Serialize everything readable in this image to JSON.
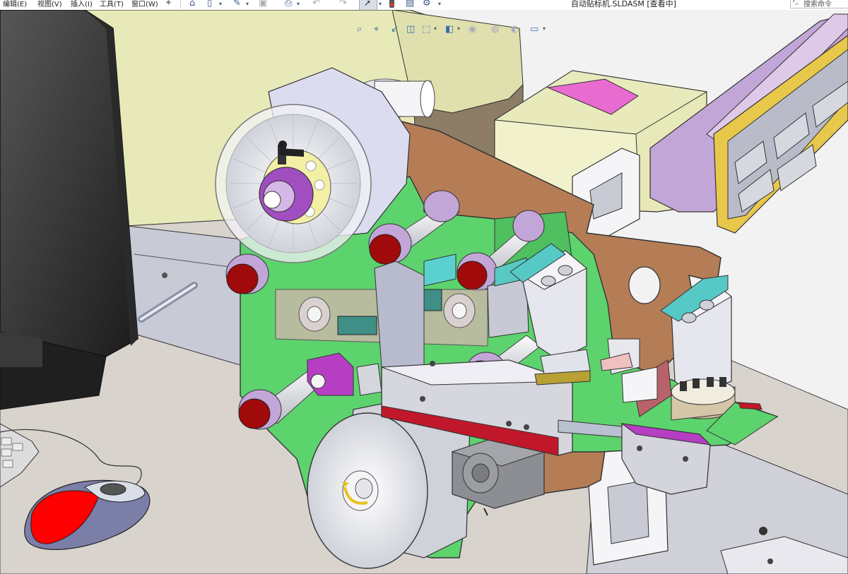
{
  "menu": {
    "edit": "编辑(E)",
    "view": "视图(V)",
    "insert": "插入(I)",
    "tools": "工具(T)",
    "window": "窗口(W)"
  },
  "window": {
    "title": "自动贴标机.SLDASM [查看中]"
  },
  "search": {
    "placeholder": "搜索命令"
  },
  "colors": {
    "background": "#f2f2f2",
    "green_panel": "#5dd36e",
    "brown_plate": "#b57d56",
    "red_roller": "#a00a0a",
    "yellow_block": "#e8e8b8",
    "magenta_label": "#e86bd0",
    "lilac": "#c3a6d8"
  },
  "icons": [
    "pin-icon",
    "home-icon",
    "new-document-icon",
    "open-icon",
    "save-icon",
    "print-icon",
    "undo-icon",
    "redo-icon",
    "select-cursor-icon",
    "traffic-light-icon",
    "file-properties-icon",
    "options-gear-icon",
    "zoom-to-fit-icon",
    "zoom-area-icon",
    "previous-view-icon",
    "section-view-icon",
    "view-orientation-icon",
    "display-style-icon",
    "hide-show-icon",
    "edit-appearance-icon",
    "apply-scene-icon",
    "view-settings-icon",
    "search-commands-icon"
  ]
}
